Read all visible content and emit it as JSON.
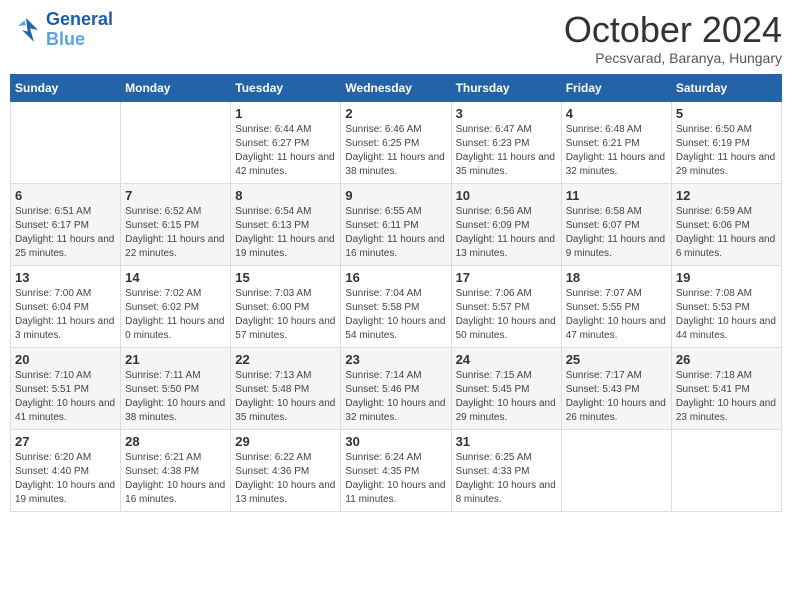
{
  "logo": {
    "line1": "General",
    "line2": "Blue"
  },
  "title": "October 2024",
  "subtitle": "Pecsvarad, Baranya, Hungary",
  "days_header": [
    "Sunday",
    "Monday",
    "Tuesday",
    "Wednesday",
    "Thursday",
    "Friday",
    "Saturday"
  ],
  "weeks": [
    [
      {
        "day": "",
        "info": ""
      },
      {
        "day": "",
        "info": ""
      },
      {
        "day": "1",
        "info": "Sunrise: 6:44 AM\nSunset: 6:27 PM\nDaylight: 11 hours and 42 minutes."
      },
      {
        "day": "2",
        "info": "Sunrise: 6:46 AM\nSunset: 6:25 PM\nDaylight: 11 hours and 38 minutes."
      },
      {
        "day": "3",
        "info": "Sunrise: 6:47 AM\nSunset: 6:23 PM\nDaylight: 11 hours and 35 minutes."
      },
      {
        "day": "4",
        "info": "Sunrise: 6:48 AM\nSunset: 6:21 PM\nDaylight: 11 hours and 32 minutes."
      },
      {
        "day": "5",
        "info": "Sunrise: 6:50 AM\nSunset: 6:19 PM\nDaylight: 11 hours and 29 minutes."
      }
    ],
    [
      {
        "day": "6",
        "info": "Sunrise: 6:51 AM\nSunset: 6:17 PM\nDaylight: 11 hours and 25 minutes."
      },
      {
        "day": "7",
        "info": "Sunrise: 6:52 AM\nSunset: 6:15 PM\nDaylight: 11 hours and 22 minutes."
      },
      {
        "day": "8",
        "info": "Sunrise: 6:54 AM\nSunset: 6:13 PM\nDaylight: 11 hours and 19 minutes."
      },
      {
        "day": "9",
        "info": "Sunrise: 6:55 AM\nSunset: 6:11 PM\nDaylight: 11 hours and 16 minutes."
      },
      {
        "day": "10",
        "info": "Sunrise: 6:56 AM\nSunset: 6:09 PM\nDaylight: 11 hours and 13 minutes."
      },
      {
        "day": "11",
        "info": "Sunrise: 6:58 AM\nSunset: 6:07 PM\nDaylight: 11 hours and 9 minutes."
      },
      {
        "day": "12",
        "info": "Sunrise: 6:59 AM\nSunset: 6:06 PM\nDaylight: 11 hours and 6 minutes."
      }
    ],
    [
      {
        "day": "13",
        "info": "Sunrise: 7:00 AM\nSunset: 6:04 PM\nDaylight: 11 hours and 3 minutes."
      },
      {
        "day": "14",
        "info": "Sunrise: 7:02 AM\nSunset: 6:02 PM\nDaylight: 11 hours and 0 minutes."
      },
      {
        "day": "15",
        "info": "Sunrise: 7:03 AM\nSunset: 6:00 PM\nDaylight: 10 hours and 57 minutes."
      },
      {
        "day": "16",
        "info": "Sunrise: 7:04 AM\nSunset: 5:58 PM\nDaylight: 10 hours and 54 minutes."
      },
      {
        "day": "17",
        "info": "Sunrise: 7:06 AM\nSunset: 5:57 PM\nDaylight: 10 hours and 50 minutes."
      },
      {
        "day": "18",
        "info": "Sunrise: 7:07 AM\nSunset: 5:55 PM\nDaylight: 10 hours and 47 minutes."
      },
      {
        "day": "19",
        "info": "Sunrise: 7:08 AM\nSunset: 5:53 PM\nDaylight: 10 hours and 44 minutes."
      }
    ],
    [
      {
        "day": "20",
        "info": "Sunrise: 7:10 AM\nSunset: 5:51 PM\nDaylight: 10 hours and 41 minutes."
      },
      {
        "day": "21",
        "info": "Sunrise: 7:11 AM\nSunset: 5:50 PM\nDaylight: 10 hours and 38 minutes."
      },
      {
        "day": "22",
        "info": "Sunrise: 7:13 AM\nSunset: 5:48 PM\nDaylight: 10 hours and 35 minutes."
      },
      {
        "day": "23",
        "info": "Sunrise: 7:14 AM\nSunset: 5:46 PM\nDaylight: 10 hours and 32 minutes."
      },
      {
        "day": "24",
        "info": "Sunrise: 7:15 AM\nSunset: 5:45 PM\nDaylight: 10 hours and 29 minutes."
      },
      {
        "day": "25",
        "info": "Sunrise: 7:17 AM\nSunset: 5:43 PM\nDaylight: 10 hours and 26 minutes."
      },
      {
        "day": "26",
        "info": "Sunrise: 7:18 AM\nSunset: 5:41 PM\nDaylight: 10 hours and 23 minutes."
      }
    ],
    [
      {
        "day": "27",
        "info": "Sunrise: 6:20 AM\nSunset: 4:40 PM\nDaylight: 10 hours and 19 minutes."
      },
      {
        "day": "28",
        "info": "Sunrise: 6:21 AM\nSunset: 4:38 PM\nDaylight: 10 hours and 16 minutes."
      },
      {
        "day": "29",
        "info": "Sunrise: 6:22 AM\nSunset: 4:36 PM\nDaylight: 10 hours and 13 minutes."
      },
      {
        "day": "30",
        "info": "Sunrise: 6:24 AM\nSunset: 4:35 PM\nDaylight: 10 hours and 11 minutes."
      },
      {
        "day": "31",
        "info": "Sunrise: 6:25 AM\nSunset: 4:33 PM\nDaylight: 10 hours and 8 minutes."
      },
      {
        "day": "",
        "info": ""
      },
      {
        "day": "",
        "info": ""
      }
    ]
  ]
}
